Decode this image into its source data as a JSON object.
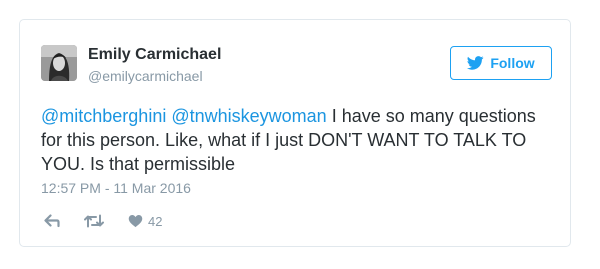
{
  "author": {
    "display_name": "Emily Carmichael",
    "handle": "@emilycarmichael",
    "avatar_icon": "profile-photo"
  },
  "follow_button": {
    "label": "Follow",
    "icon": "twitter-bird-icon",
    "color": "#1da1f2"
  },
  "tweet": {
    "mention_1": "@mitchberghini",
    "mention_2": "@tnwhiskeywoman",
    "body": " I have so many questions for this person. Like, what if I just DON'T WANT TO TALK TO YOU. Is that permissible",
    "timestamp": "12:57 PM - 11 Mar 2016"
  },
  "actions": {
    "reply_icon": "reply-icon",
    "retweet_icon": "retweet-icon",
    "like_icon": "heart-icon",
    "like_count": "42"
  },
  "colors": {
    "link": "#1b95e0",
    "meta": "#8899a6",
    "text": "#292f33",
    "border": "#e1e8ed"
  }
}
